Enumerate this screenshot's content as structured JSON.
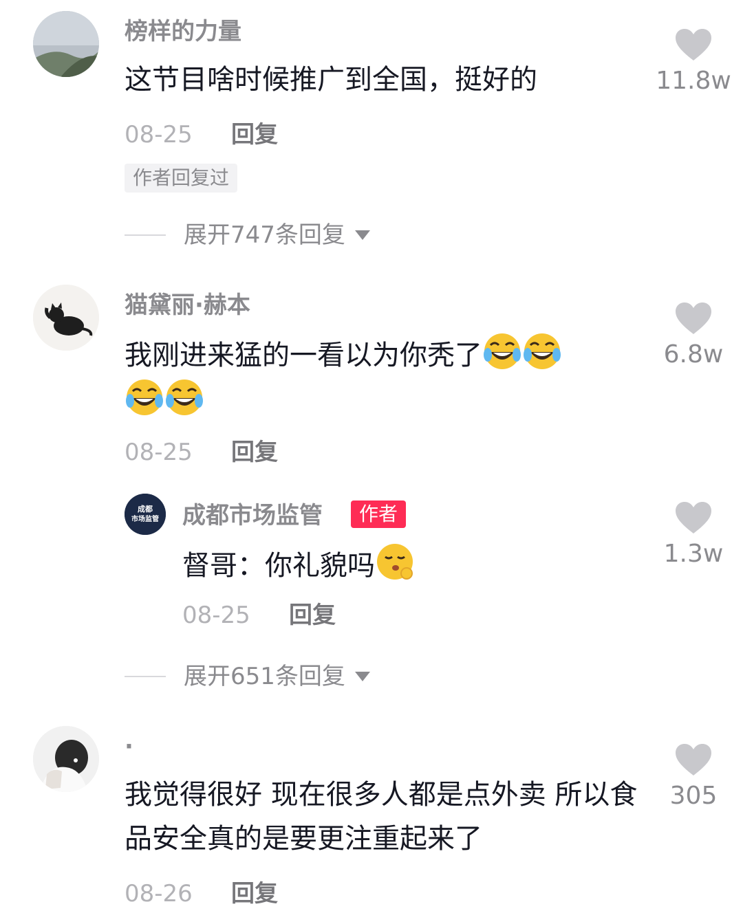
{
  "comments": [
    {
      "username": "榜样的力量",
      "text": "这节目啥时候推广到全国，挺好的",
      "date": "08-25",
      "reply_label": "回复",
      "author_replied_tag": "作者回复过",
      "likes": "11.8w",
      "expand_label": "展开747条回复"
    },
    {
      "username": "猫黛丽·赫本",
      "text": "我刚进来猛的一看以为你秃了",
      "emoji": "laughing-crying-emoji",
      "date": "08-25",
      "reply_label": "回复",
      "likes": "6.8w",
      "reply": {
        "avatar_text_line1": "成都",
        "avatar_text_line2": "市场监管",
        "username": "成都市场监管",
        "author_tag": "作者",
        "text": "督哥：你礼貌吗",
        "emoji": "shushing-face-emoji",
        "date": "08-25",
        "reply_label": "回复",
        "likes": "1.3w"
      },
      "expand_label": "展开651条回复"
    },
    {
      "username": "·",
      "text": "我觉得很好 现在很多人都是点外卖 所以食品安全真的是要更注重起来了",
      "date": "08-26",
      "reply_label": "回复",
      "likes": "305"
    }
  ],
  "colors": {
    "author_tag_bg": "#fe2c55",
    "username": "#8a8a8e",
    "comment_text": "#161823",
    "heart": "#c8c8cc"
  }
}
